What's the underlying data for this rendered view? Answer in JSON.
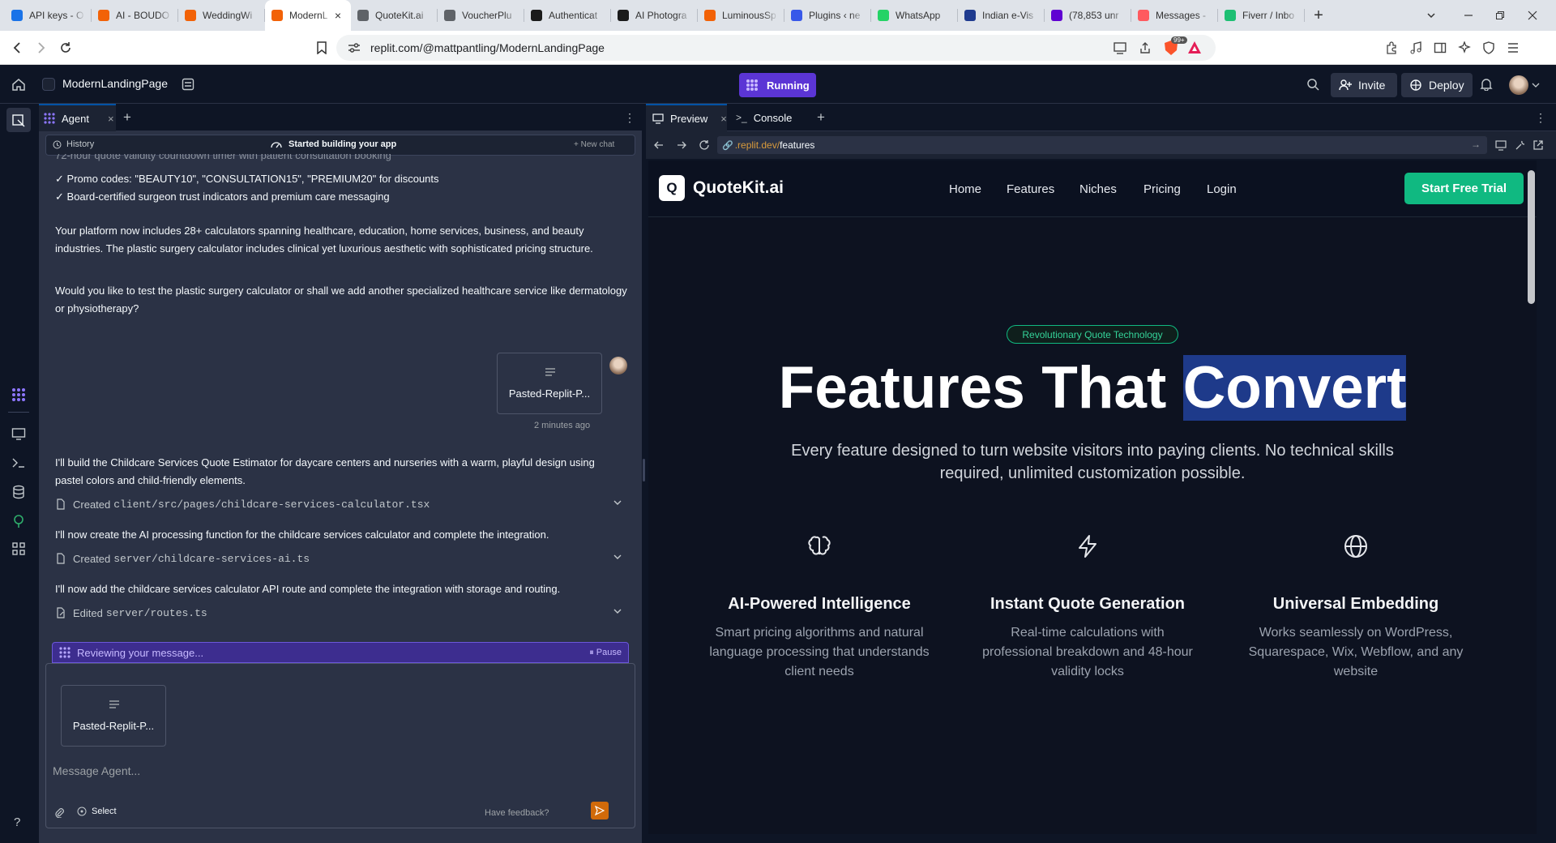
{
  "browser": {
    "tabs": [
      {
        "label": "API keys - O",
        "icon_color": "#1a73e8"
      },
      {
        "label": "AI - BOUDO",
        "icon_color": "#f26207"
      },
      {
        "label": "WeddingWi",
        "icon_color": "#f26207"
      },
      {
        "label": "ModernL",
        "icon_color": "#f26207",
        "active": true
      },
      {
        "label": "QuoteKit.ai",
        "icon_color": "#5f6368"
      },
      {
        "label": "VoucherPlu",
        "icon_color": "#5f6368"
      },
      {
        "label": "Authenticat",
        "icon_color": "#1b1b1b"
      },
      {
        "label": "AI Photogra",
        "icon_color": "#1b1b1b"
      },
      {
        "label": "LuminousSp",
        "icon_color": "#f26207"
      },
      {
        "label": "Plugins ‹ ne",
        "icon_color": "#3858e9"
      },
      {
        "label": "WhatsApp",
        "icon_color": "#25d366"
      },
      {
        "label": "Indian e-Vis",
        "icon_color": "#1f3b8f"
      },
      {
        "label": "(78,853 unr",
        "icon_color": "#6001d2"
      },
      {
        "label": "Messages -",
        "icon_color": "#ff5a5f"
      },
      {
        "label": "Fiverr / Inbo",
        "icon_color": "#1dbf73"
      }
    ],
    "url": "replit.com/@mattpantling/ModernLandingPage",
    "brave_badge": "99+"
  },
  "replit": {
    "project_name": "ModernLandingPage",
    "run_status": "Running",
    "invite_label": "Invite",
    "deploy_label": "Deploy"
  },
  "agent": {
    "tab_label": "Agent",
    "history_label": "History",
    "status_label": "Started building your app",
    "new_chat_label": "New chat",
    "cut_line": "72-hour quote validity countdown timer with patient consultation booking",
    "check_lines": [
      "Promo codes: \"BEAUTY10\", \"CONSULTATION15\", \"PREMIUM20\" for discounts",
      "Board-certified surgeon trust indicators and premium care messaging"
    ],
    "check_mark": "✓",
    "para1": "Your platform now includes 28+ calculators spanning healthcare, education, home services, business, and beauty industries. The plastic surgery calculator includes clinical yet luxurious aesthetic with sophisticated pricing structure.",
    "para2": "Would you like to test the plastic surgery calculator or shall we add another specialized healthcare service like dermatology or physiotherapy?",
    "user_attachment": "Pasted-Replit-P...",
    "user_time": "2 minutes ago",
    "reply1": "I'll build the Childcare Services Quote Estimator for daycare centers and nurseries with a warm, playful design using pastel colors and child-friendly elements.",
    "file1_action": "Created",
    "file1_path": "client/src/pages/childcare-services-calculator.tsx",
    "reply2": "I'll now create the AI processing function for the childcare services calculator and complete the integration.",
    "file2_action": "Created",
    "file2_path": "server/childcare-services-ai.ts",
    "reply3": "I'll now add the childcare services calculator API route and complete the integration with storage and routing.",
    "file3_action": "Edited",
    "file3_path": "server/routes.ts",
    "reviewing_label": "Reviewing your message...",
    "pause_label": "Pause",
    "composer_attachment": "Pasted-Replit-P...",
    "input_placeholder": "Message Agent...",
    "select_label": "Select",
    "feedback_label": "Have feedback?"
  },
  "preview": {
    "tab_preview": "Preview",
    "tab_console": "Console",
    "url_prefix": ".replit.dev/",
    "url_path": "features"
  },
  "site": {
    "logo_letter": "Q",
    "brand": "QuoteKit.ai",
    "nav": [
      "Home",
      "Features",
      "Niches",
      "Pricing",
      "Login"
    ],
    "cta": "Start Free Trial",
    "badge": "Revolutionary Quote Technology",
    "hero_part1": "Features That ",
    "hero_highlight": "Convert",
    "subtitle": "Every feature designed to turn website visitors into paying clients. No technical skills required, unlimited customization possible.",
    "features": [
      {
        "icon": "brain-icon",
        "title": "AI-Powered Intelligence",
        "text": "Smart pricing algorithms and natural language processing that understands client needs"
      },
      {
        "icon": "zap-icon",
        "title": "Instant Quote Generation",
        "text": "Real-time calculations with professional breakdown and 48-hour validity locks"
      },
      {
        "icon": "globe-icon",
        "title": "Universal Embedding",
        "text": "Works seamlessly on WordPress, Squarespace, Wix, Webflow, and any website"
      }
    ],
    "accent": "#10b981",
    "highlight_bg": "#1e3a8a"
  },
  "help_label": "?"
}
